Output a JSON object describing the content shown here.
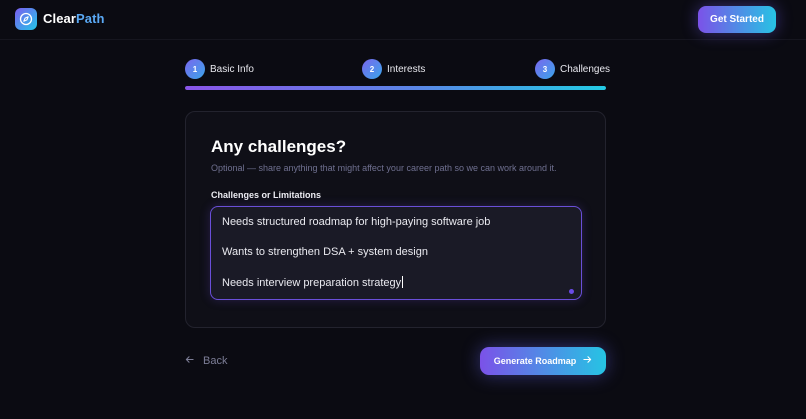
{
  "app": {
    "brand_part1": "Clear",
    "brand_part2": "Path",
    "logo_icon": "compass-icon",
    "get_started_label": "Get Started"
  },
  "colors": {
    "background": "#0b0b12",
    "accent_start": "#7b52e8",
    "accent_end": "#26c4e4",
    "brand_blue": "#5aa9f5"
  },
  "steps": [
    {
      "number": "1",
      "label": "Basic Info"
    },
    {
      "number": "2",
      "label": "Interests"
    },
    {
      "number": "3",
      "label": "Challenges"
    }
  ],
  "progress": {
    "percent": 100
  },
  "form": {
    "title": "Any challenges?",
    "subtitle": "Optional — share anything that might affect your career path so we can work around it.",
    "field_label": "Challenges or Limitations",
    "lines": [
      "Needs structured roadmap for high-paying software job",
      "Wants to strengthen DSA + system design",
      "Needs interview preparation strategy"
    ]
  },
  "actions": {
    "back_label": "Back",
    "back_icon": "arrow-left-icon",
    "generate_label": "Generate Roadmap",
    "generate_icon": "arrow-right-icon"
  }
}
